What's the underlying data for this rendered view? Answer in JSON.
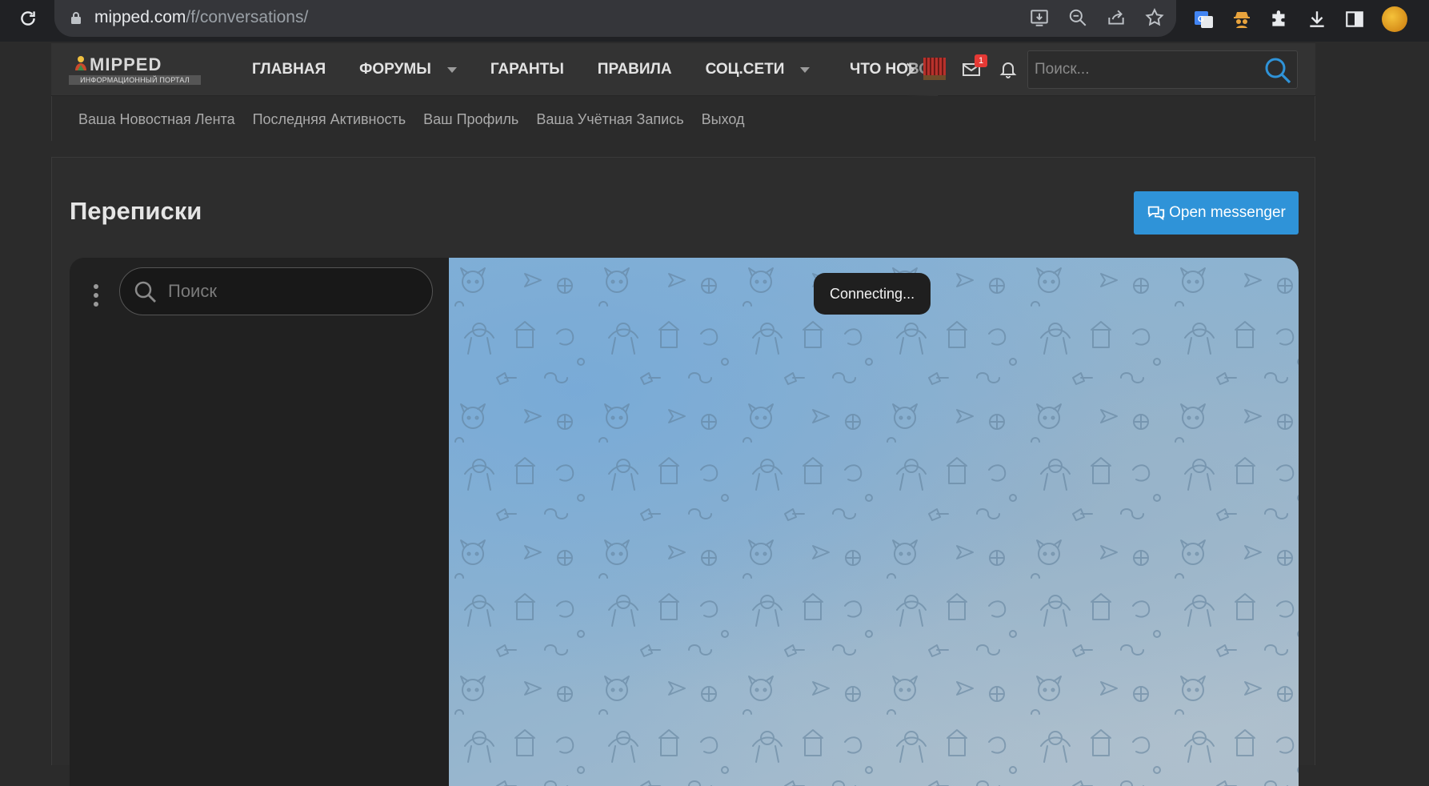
{
  "browser": {
    "url_host": "mipped.com",
    "url_path": "/f/conversations/",
    "omnibox_icons": [
      "install-icon",
      "zoom-out-icon",
      "share-icon",
      "star-icon"
    ],
    "extension_icons": [
      "translate-icon",
      "spy-icon",
      "puzzle-icon",
      "download-icon",
      "sidepanel-icon",
      "profile-avatar"
    ]
  },
  "site": {
    "logo_title": "MIPPED",
    "logo_subtitle": "ИНФОРМАЦИОННЫЙ ПОРТАЛ",
    "nav": [
      {
        "label": "ГЛАВНАЯ",
        "has_dropdown": false
      },
      {
        "label": "ФОРУМЫ",
        "has_dropdown": true
      },
      {
        "label": "ГАРАНТЫ",
        "has_dropdown": false
      },
      {
        "label": "ПРАВИЛА",
        "has_dropdown": false
      },
      {
        "label": "СОЦ.СЕТИ",
        "has_dropdown": true
      }
    ],
    "nav_overflow_label": "ЧТО НОВОГО",
    "inbox_badge": "1",
    "search_placeholder": "Поиск...",
    "subnav": [
      "Ваша Новостная Лента",
      "Последняя Активность",
      "Ваш Профиль",
      "Ваша Учётная Запись",
      "Выход"
    ],
    "accent_color": "#2f93d8"
  },
  "page": {
    "title": "Переписки",
    "open_messenger_label": "Open messenger"
  },
  "messenger": {
    "search_placeholder": "Поиск",
    "status_toast": "Connecting..."
  }
}
